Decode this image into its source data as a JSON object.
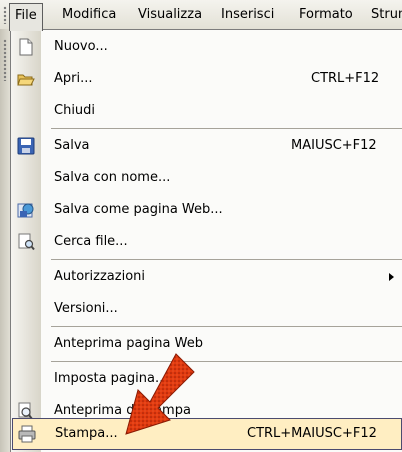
{
  "menubar": {
    "items": [
      {
        "label": "File"
      },
      {
        "label": "Modifica"
      },
      {
        "label": "Visualizza"
      },
      {
        "label": "Inserisci"
      },
      {
        "label": "Formato"
      },
      {
        "label": "Strum"
      }
    ]
  },
  "menu": {
    "items": [
      {
        "label": "Nuovo...",
        "shortcut": "",
        "icon": "new-document-icon"
      },
      {
        "label": "Apri...",
        "shortcut": "CTRL+F12",
        "icon": "open-folder-icon"
      },
      {
        "label": "Chiudi",
        "shortcut": "",
        "icon": ""
      },
      {
        "label": "Salva",
        "shortcut": "MAIUSC+F12",
        "icon": "save-disk-icon"
      },
      {
        "label": "Salva con nome...",
        "shortcut": "",
        "icon": ""
      },
      {
        "label": "Salva come pagina Web...",
        "shortcut": "",
        "icon": "save-web-icon"
      },
      {
        "label": "Cerca file...",
        "shortcut": "",
        "icon": "search-file-icon"
      },
      {
        "label": "Autorizzazioni",
        "shortcut": "",
        "icon": "",
        "submenu": true
      },
      {
        "label": "Versioni...",
        "shortcut": "",
        "icon": ""
      },
      {
        "label": "Anteprima pagina Web",
        "shortcut": "",
        "icon": ""
      },
      {
        "label": "Imposta pagina...",
        "shortcut": "",
        "icon": ""
      },
      {
        "label": "Anteprima di stampa",
        "shortcut": "",
        "icon": "print-preview-icon"
      },
      {
        "label": "Stampa...",
        "shortcut": "CTRL+MAIUSC+F12",
        "icon": "printer-icon",
        "highlighted": true
      }
    ]
  },
  "colors": {
    "highlight_bg": "#ffeec2",
    "pointer_arrow": "#e23b10"
  }
}
